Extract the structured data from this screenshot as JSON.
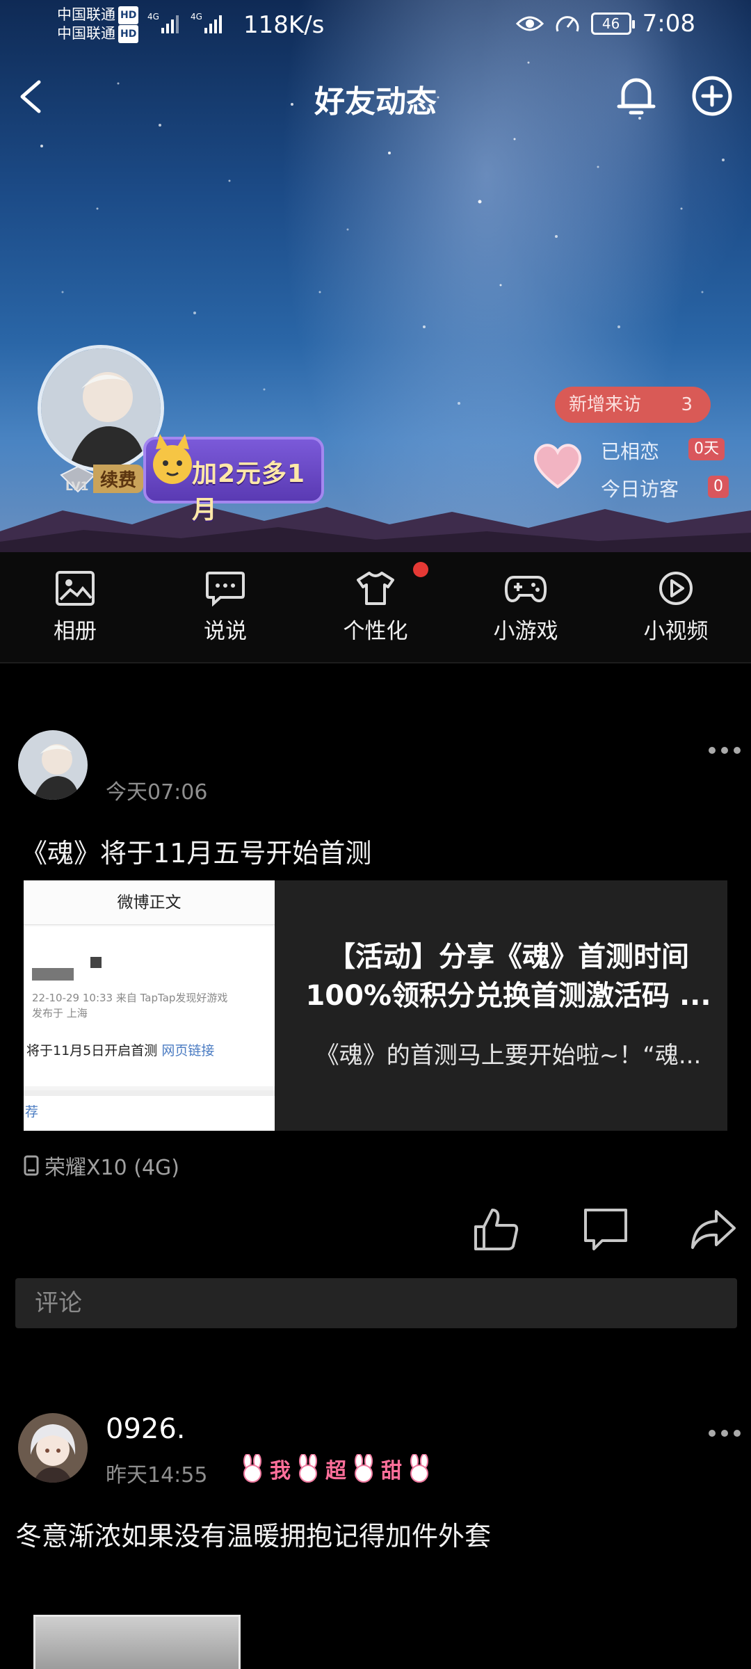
{
  "status_bar": {
    "carrier1": "中国联通",
    "carrier2": "中国联通",
    "hd": "HD",
    "net": "4G",
    "speed": "118K/s",
    "battery": "46",
    "time": "7:08"
  },
  "header": {
    "title": "好友动态"
  },
  "profile": {
    "level": "LV1",
    "renew_label": "续费",
    "promo_text": "加2元多1月",
    "new_visits_label": "新增来访",
    "new_visits_count": "3",
    "together_label": "已相恋",
    "together_value": "0天",
    "today_visitors_label": "今日访客",
    "today_visitors_value": "0"
  },
  "shortcuts": [
    {
      "label": "相册",
      "icon": "image-icon"
    },
    {
      "label": "说说",
      "icon": "chat-bubble-icon"
    },
    {
      "label": "个性化",
      "icon": "shirt-icon"
    },
    {
      "label": "小游戏",
      "icon": "gamepad-icon"
    },
    {
      "label": "小视频",
      "icon": "play-circle-icon"
    }
  ],
  "posts": [
    {
      "time": "今天07:06",
      "text": "《魂》将于11月五号开始首测",
      "link_card": {
        "thumb_header": "微博正文",
        "thumb_meta1": "22-10-29 10:33  来自 TapTap发现好游戏",
        "thumb_meta2": "发布于 上海",
        "thumb_body": "将于11月5日开启首测",
        "thumb_link": "网页链接",
        "thumb_footer": "荐",
        "title_line1": "【活动】分享《魂》首测时间",
        "title_line2": "100%领积分兑换首测激活码 ...",
        "desc": "《魂》的首测马上要开始啦~！“魂..."
      },
      "device": "荣耀X10 (4G)",
      "comment_placeholder": "评论"
    },
    {
      "username": "0926.",
      "time": "昨天14:55",
      "sticker_text": [
        "我",
        "超",
        "甜"
      ],
      "text": "冬意渐浓如果没有温暖拥抱记得加件外套"
    }
  ]
}
